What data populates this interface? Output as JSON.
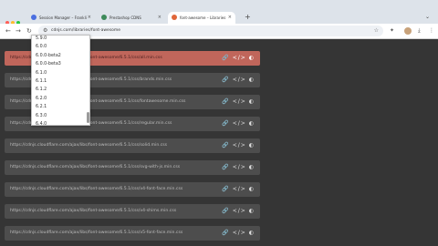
{
  "colors": {
    "tabstrip_bg": "#dde3ea",
    "content_bg": "#353535",
    "row_bg": "#4d4d4d",
    "row_highlight_bg": "#c0665b",
    "window_close": "#ff5f57",
    "window_minimize": "#febc2e",
    "window_maximize": "#28c840"
  },
  "tabs": [
    {
      "title": "Session Manager – Franklin",
      "favicon_color": "#4a6ee0",
      "active": false
    },
    {
      "title": "Prestashop CDNS",
      "favicon_color": "#3d8a5a",
      "active": false
    },
    {
      "title": "font-awesome – Libraries – cdnjs",
      "favicon_color": "#e0663a",
      "active": true
    }
  ],
  "tab_close": "×",
  "new_tab": "+",
  "tab_menu": "⌄",
  "toolbar": {
    "back": "←",
    "forward": "→",
    "reload": "↻",
    "url": "cdnjs.com/libraries/font-awesome",
    "icons": [
      "bookmark-star-icon",
      "extensions-icon",
      "download-icon",
      "profile-avatar",
      "menu-icon"
    ]
  },
  "version_dropdown": {
    "options": [
      "5.9.0",
      "6.0.0",
      "6.0.0-beta2",
      "6.0.0-beta3",
      "6.1.0",
      "6.1.1",
      "6.1.2",
      "6.2.0",
      "6.2.1",
      "6.3.0",
      "6.4.0"
    ]
  },
  "cdn_rows": [
    {
      "url": "https://cdnjs.cloudflare.com/ajax/libs/font-awesome/6.5.1/css/all.min.css",
      "highlighted": true
    },
    {
      "url": "https://cdnjs.cloudflare.com/ajax/libs/font-awesome/6.5.1/css/brands.min.css",
      "highlighted": false
    },
    {
      "url": "https://cdnjs.cloudflare.com/ajax/libs/font-awesome/6.5.1/css/fontawesome.min.css",
      "highlighted": false
    },
    {
      "url": "https://cdnjs.cloudflare.com/ajax/libs/font-awesome/6.5.1/css/regular.min.css",
      "highlighted": false
    },
    {
      "url": "https://cdnjs.cloudflare.com/ajax/libs/font-awesome/6.5.1/css/solid.min.css",
      "highlighted": false
    },
    {
      "url": "https://cdnjs.cloudflare.com/ajax/libs/font-awesome/6.5.1/css/svg-with-js.min.css",
      "highlighted": false
    },
    {
      "url": "https://cdnjs.cloudflare.com/ajax/libs/font-awesome/6.5.1/css/v4-font-face.min.css",
      "highlighted": false
    },
    {
      "url": "https://cdnjs.cloudflare.com/ajax/libs/font-awesome/6.5.1/css/v4-shims.min.css",
      "highlighted": false
    },
    {
      "url": "https://cdnjs.cloudflare.com/ajax/libs/font-awesome/6.5.1/css/v5-font-face.min.css",
      "highlighted": false
    }
  ],
  "row_actions": {
    "copy_url": "🔗",
    "copy_tag": "</>",
    "copy_sri": "◐"
  }
}
